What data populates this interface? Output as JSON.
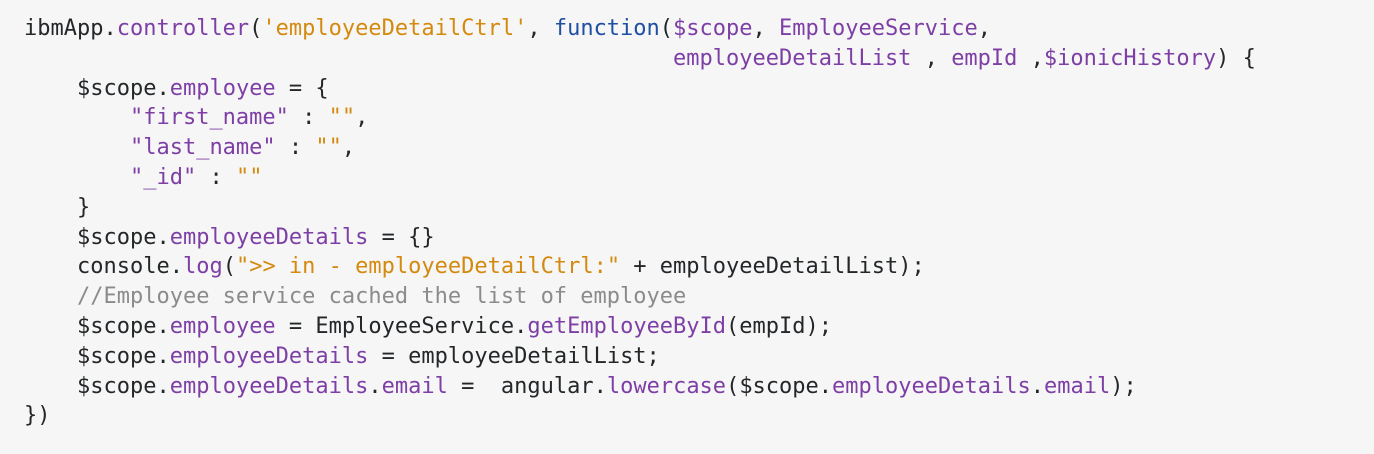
{
  "code": {
    "lines": [
      [
        {
          "t": "ibmApp.",
          "c": "plain"
        },
        {
          "t": "controller",
          "c": "prop"
        },
        {
          "t": "(",
          "c": "plain"
        },
        {
          "t": "'employeeDetailCtrl'",
          "c": "str"
        },
        {
          "t": ", ",
          "c": "plain"
        },
        {
          "t": "function",
          "c": "kw"
        },
        {
          "t": "(",
          "c": "plain"
        },
        {
          "t": "$scope",
          "c": "prop"
        },
        {
          "t": ", ",
          "c": "plain"
        },
        {
          "t": "EmployeeService",
          "c": "prop"
        },
        {
          "t": ",",
          "c": "plain"
        }
      ],
      [
        {
          "t": "                                                 ",
          "c": "plain"
        },
        {
          "t": "employeeDetailList",
          "c": "prop"
        },
        {
          "t": " , ",
          "c": "plain"
        },
        {
          "t": "empId",
          "c": "prop"
        },
        {
          "t": " ,",
          "c": "plain"
        },
        {
          "t": "$ionicHistory",
          "c": "prop"
        },
        {
          "t": ") {",
          "c": "plain"
        }
      ],
      [
        {
          "t": "    ",
          "c": "plain"
        },
        {
          "t": "$scope",
          "c": "plain"
        },
        {
          "t": ".",
          "c": "plain"
        },
        {
          "t": "employee",
          "c": "prop"
        },
        {
          "t": " = {",
          "c": "plain"
        }
      ],
      [
        {
          "t": "        ",
          "c": "plain"
        },
        {
          "t": "\"first_name\"",
          "c": "prop"
        },
        {
          "t": " : ",
          "c": "plain"
        },
        {
          "t": "\"\"",
          "c": "str"
        },
        {
          "t": ",",
          "c": "plain"
        }
      ],
      [
        {
          "t": "        ",
          "c": "plain"
        },
        {
          "t": "\"last_name\"",
          "c": "prop"
        },
        {
          "t": " : ",
          "c": "plain"
        },
        {
          "t": "\"\"",
          "c": "str"
        },
        {
          "t": ",",
          "c": "plain"
        }
      ],
      [
        {
          "t": "        ",
          "c": "plain"
        },
        {
          "t": "\"_id\"",
          "c": "prop"
        },
        {
          "t": " : ",
          "c": "plain"
        },
        {
          "t": "\"\"",
          "c": "str"
        }
      ],
      [
        {
          "t": "    }",
          "c": "plain"
        }
      ],
      [
        {
          "t": "    ",
          "c": "plain"
        },
        {
          "t": "$scope",
          "c": "plain"
        },
        {
          "t": ".",
          "c": "plain"
        },
        {
          "t": "employeeDetails",
          "c": "prop"
        },
        {
          "t": " = {}",
          "c": "plain"
        }
      ],
      [
        {
          "t": "    console.",
          "c": "plain"
        },
        {
          "t": "log",
          "c": "prop"
        },
        {
          "t": "(",
          "c": "plain"
        },
        {
          "t": "\">> in - employeeDetailCtrl:\"",
          "c": "str"
        },
        {
          "t": " + employeeDetailList);",
          "c": "plain"
        }
      ],
      [
        {
          "t": "    ",
          "c": "plain"
        },
        {
          "t": "//Employee service cached the list of employee",
          "c": "cmt"
        }
      ],
      [
        {
          "t": "    ",
          "c": "plain"
        },
        {
          "t": "$scope",
          "c": "plain"
        },
        {
          "t": ".",
          "c": "plain"
        },
        {
          "t": "employee",
          "c": "prop"
        },
        {
          "t": " = EmployeeService.",
          "c": "plain"
        },
        {
          "t": "getEmployeeById",
          "c": "prop"
        },
        {
          "t": "(empId);",
          "c": "plain"
        }
      ],
      [
        {
          "t": "    ",
          "c": "plain"
        },
        {
          "t": "$scope",
          "c": "plain"
        },
        {
          "t": ".",
          "c": "plain"
        },
        {
          "t": "employeeDetails",
          "c": "prop"
        },
        {
          "t": " = employeeDetailList;",
          "c": "plain"
        }
      ],
      [
        {
          "t": "    ",
          "c": "plain"
        },
        {
          "t": "$scope",
          "c": "plain"
        },
        {
          "t": ".",
          "c": "plain"
        },
        {
          "t": "employeeDetails",
          "c": "prop"
        },
        {
          "t": ".",
          "c": "plain"
        },
        {
          "t": "email",
          "c": "prop"
        },
        {
          "t": " =  angular.",
          "c": "plain"
        },
        {
          "t": "lowercase",
          "c": "prop"
        },
        {
          "t": "(",
          "c": "plain"
        },
        {
          "t": "$scope",
          "c": "plain"
        },
        {
          "t": ".",
          "c": "plain"
        },
        {
          "t": "employeeDetails",
          "c": "prop"
        },
        {
          "t": ".",
          "c": "plain"
        },
        {
          "t": "email",
          "c": "prop"
        },
        {
          "t": ");",
          "c": "plain"
        }
      ],
      [
        {
          "t": "})",
          "c": "plain"
        }
      ]
    ]
  }
}
